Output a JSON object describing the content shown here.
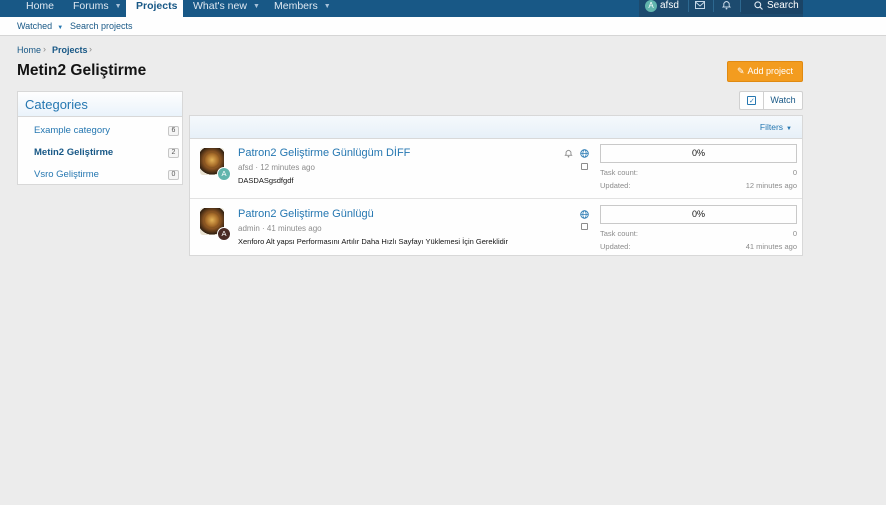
{
  "nav": {
    "tabs": [
      {
        "label": "Home"
      },
      {
        "label": "Forums"
      },
      {
        "label": "Projects"
      },
      {
        "label": "What's new"
      },
      {
        "label": "Members"
      }
    ],
    "user": {
      "name": "afsd",
      "initial": "A"
    },
    "search_label": "Search"
  },
  "subnav": {
    "watched": "Watched",
    "search_projects": "Search projects"
  },
  "breadcrumb": {
    "home": "Home",
    "projects": "Projects"
  },
  "page": {
    "title": "Metin2 Geliştirme",
    "add_project": "Add project"
  },
  "categories": {
    "title": "Categories",
    "items": [
      {
        "label": "Example category",
        "count": "6"
      },
      {
        "label": "Metin2 Geliştirme",
        "count": "2"
      },
      {
        "label": "Vsro Geliştirme",
        "count": "0"
      }
    ]
  },
  "watch_label": "Watch",
  "filters_label": "Filters",
  "projects": [
    {
      "title": "Patron2 Geliştirme Günlügüm DİFF",
      "meta": "afsd · 12 minutes ago",
      "description": "DASDASgsdfgdf",
      "user_initial": "A",
      "user_color": "#62b5ad",
      "progress": "0%",
      "task_count_label": "Task count:",
      "task_count": "0",
      "updated_label": "Updated:",
      "updated": "12 minutes ago"
    },
    {
      "title": "Patron2 Geliştirme Günlügü",
      "meta": "admin · 41 minutes ago",
      "description": "Xenforo Alt yapsı Performasını Artılır Daha Hızlı Sayfayı Yüklemesi İçin Gereklidir",
      "user_initial": "A",
      "user_color": "#4a2b25",
      "progress": "0%",
      "task_count_label": "Task count:",
      "task_count": "0",
      "updated_label": "Updated:",
      "updated": "41 minutes ago"
    }
  ],
  "colors": {
    "nav_bg": "#185886",
    "accent": "#f39c1f",
    "link": "#2577b1"
  }
}
